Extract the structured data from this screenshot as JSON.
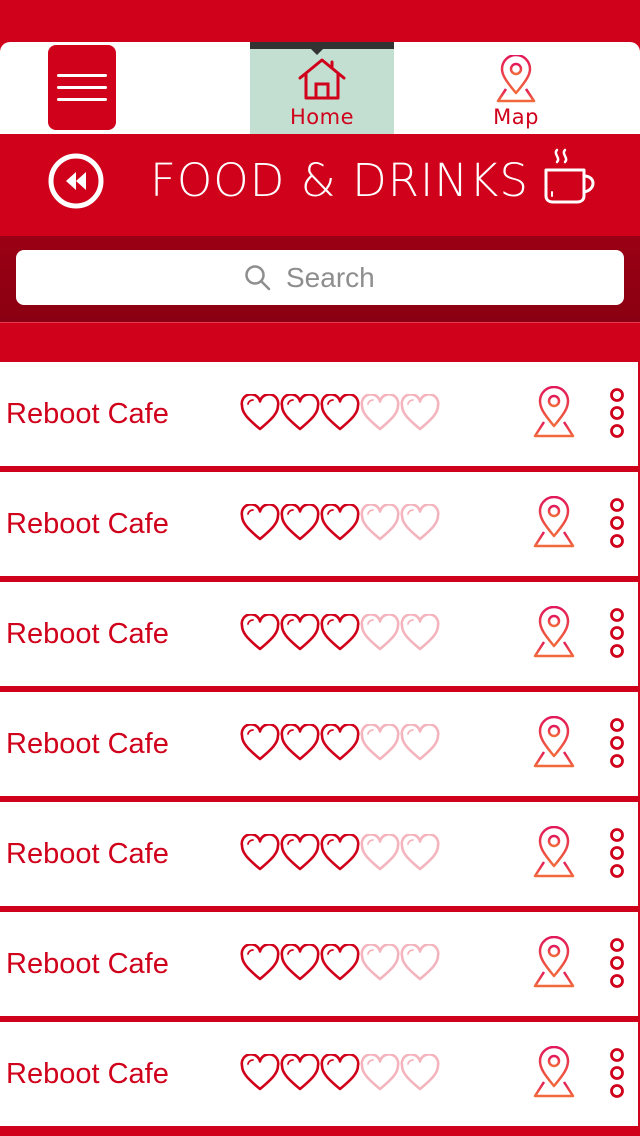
{
  "nav": {
    "tabs": [
      {
        "label": "Home",
        "icon": "house-icon",
        "active": true
      },
      {
        "label": "Map",
        "icon": "map-pin-icon",
        "active": false
      }
    ]
  },
  "header": {
    "title": "FOOD & DRINKS",
    "back_icon": "rewind-icon",
    "category_icon": "coffee-cup-icon"
  },
  "search": {
    "placeholder": "Search"
  },
  "list": {
    "items": [
      {
        "name": "Reboot Cafe",
        "rating": 3,
        "max_rating": 5
      },
      {
        "name": "Reboot Cafe",
        "rating": 3,
        "max_rating": 5
      },
      {
        "name": "Reboot Cafe",
        "rating": 3,
        "max_rating": 5
      },
      {
        "name": "Reboot Cafe",
        "rating": 3,
        "max_rating": 5
      },
      {
        "name": "Reboot Cafe",
        "rating": 3,
        "max_rating": 5
      },
      {
        "name": "Reboot Cafe",
        "rating": 3,
        "max_rating": 5
      },
      {
        "name": "Reboot Cafe",
        "rating": 3,
        "max_rating": 5
      }
    ]
  },
  "colors": {
    "primary": "#d0011b",
    "dark_band": "#8a0012",
    "active_tab": "#c2dfd2",
    "heart_filled": "#d0011b",
    "heart_empty": "#f3b4bd",
    "pin_gradient_top": "#e2185a",
    "pin_gradient_bottom": "#f26a3b"
  }
}
